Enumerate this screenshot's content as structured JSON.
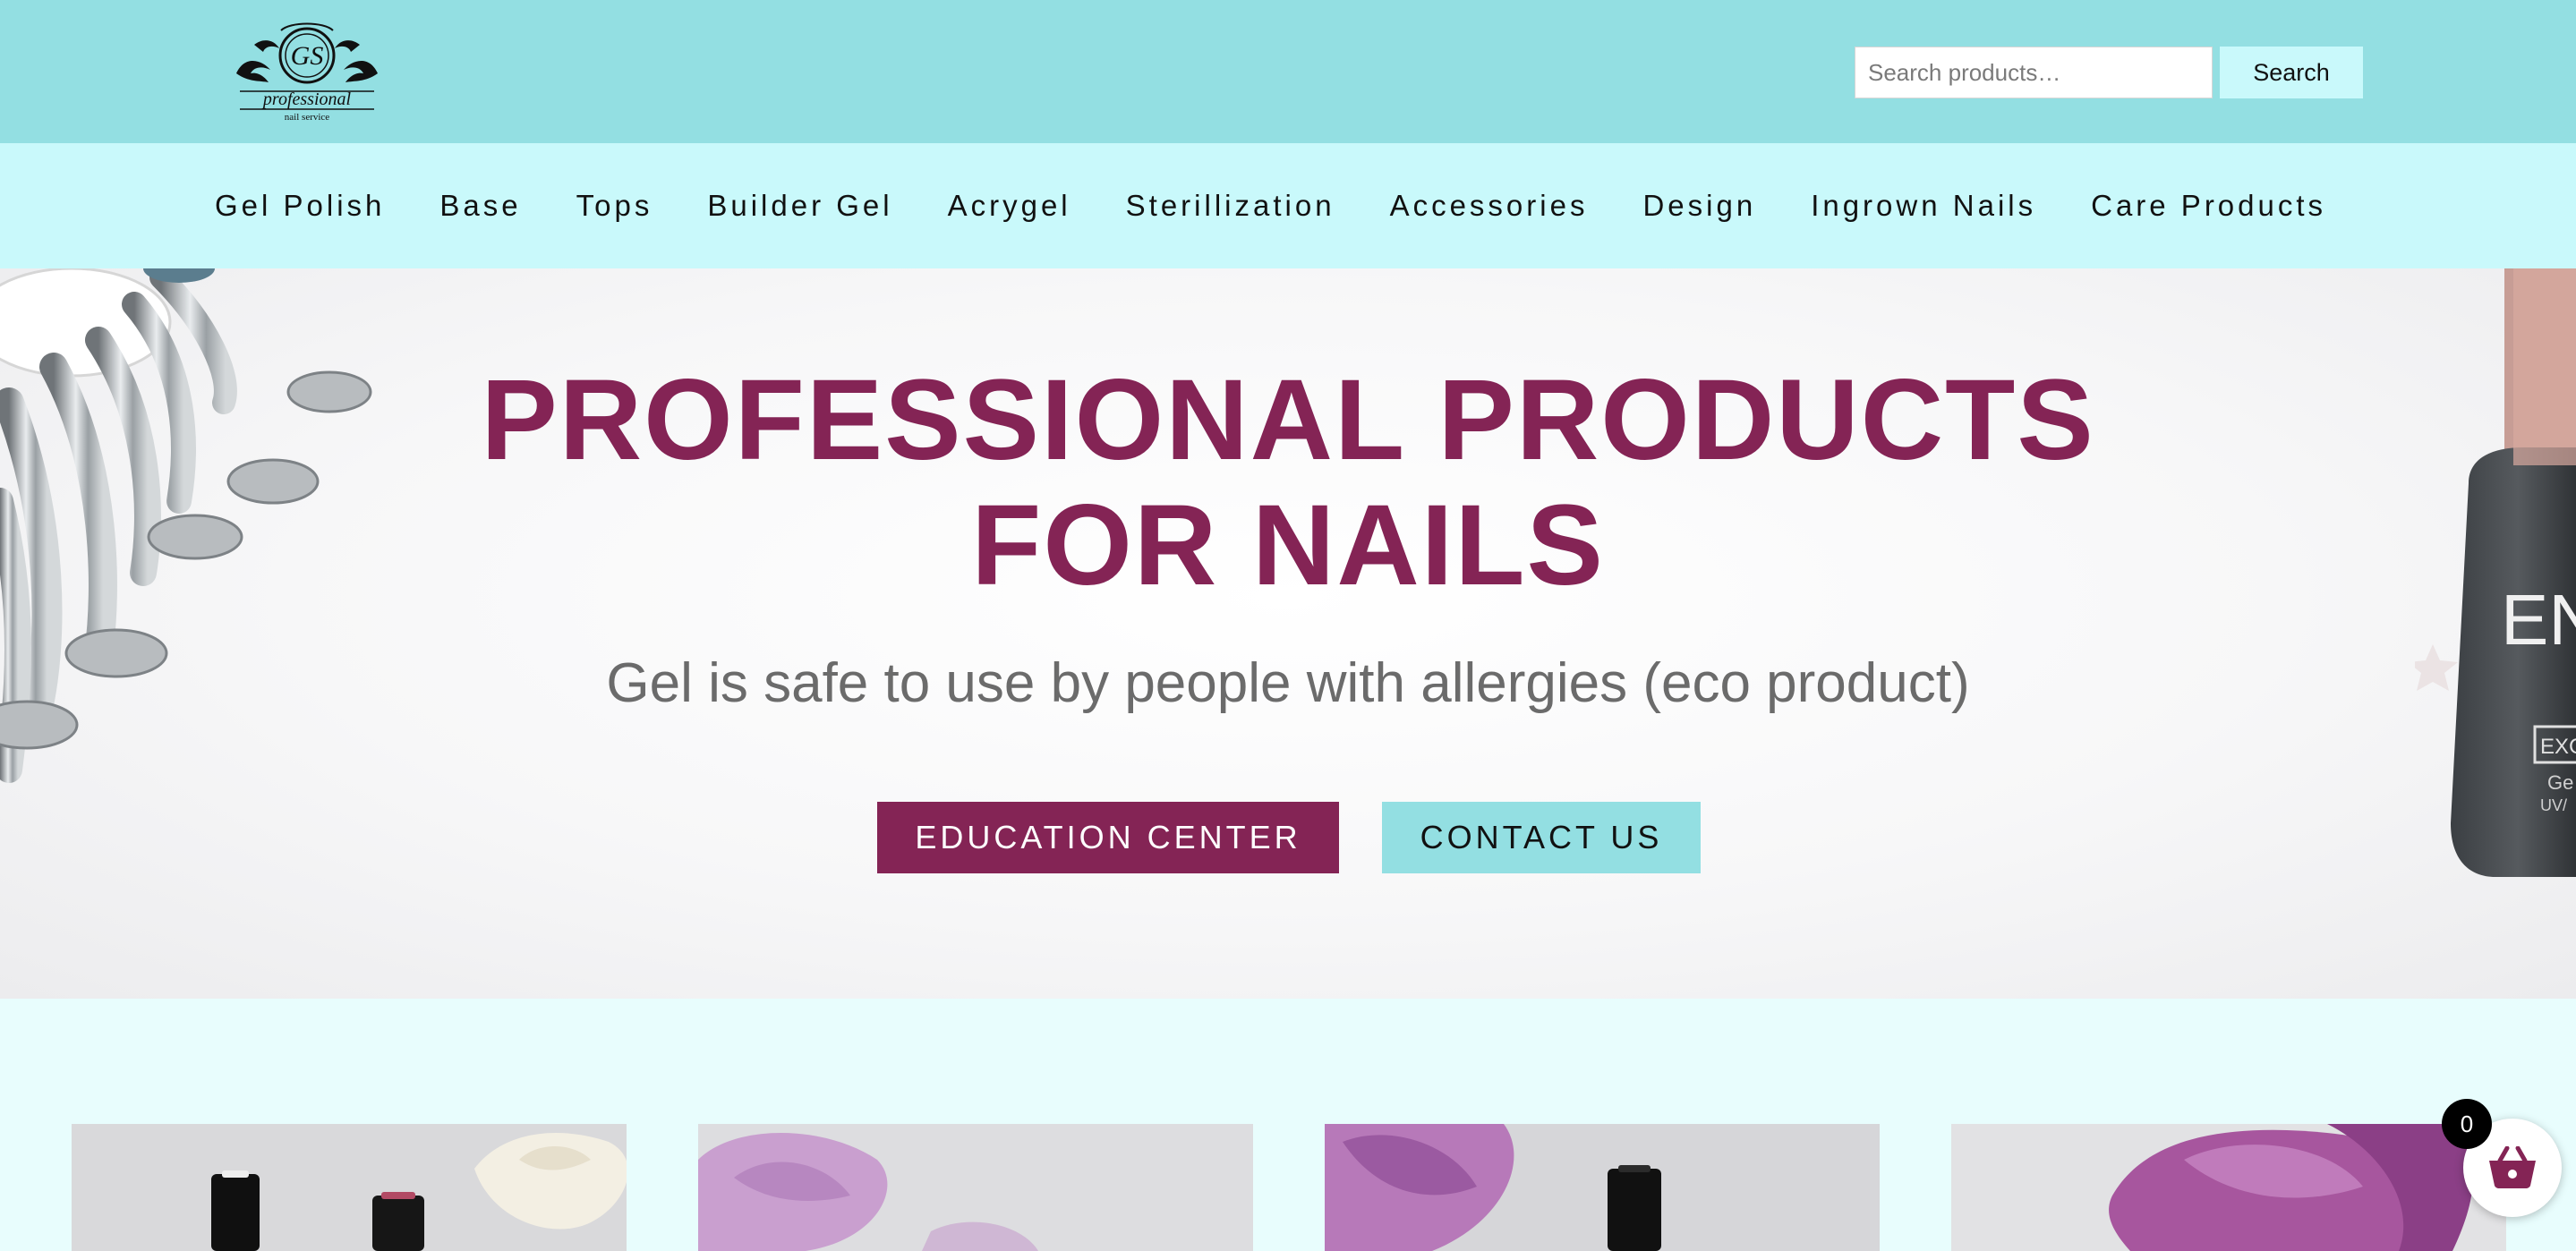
{
  "header": {
    "logo_alt": "GS professional nail service",
    "search": {
      "placeholder": "Search products…",
      "button_label": "Search"
    }
  },
  "nav": {
    "items": [
      "Gel Polish",
      "Base",
      "Tops",
      "Builder Gel",
      "Acrygel",
      "Sterillization",
      "Accessories",
      "Design",
      "Ingrown Nails",
      "Care Products"
    ]
  },
  "hero": {
    "title": "PROFESSIONAL PRODUCTS\nFOR  NAILS",
    "subtitle": "Gel is safe to use by people with allergies (eco product)",
    "primary_button": "EDUCATION CENTER",
    "secondary_button": "CONTACT US"
  },
  "cart": {
    "count": "0",
    "icon": "basket-icon"
  },
  "colors": {
    "header_bg": "#93dfe2",
    "nav_bg": "#c9f9fb",
    "page_bg": "#e8fdfd",
    "brand_magenta": "#842455",
    "subtitle_gray": "#6b6b6b"
  }
}
